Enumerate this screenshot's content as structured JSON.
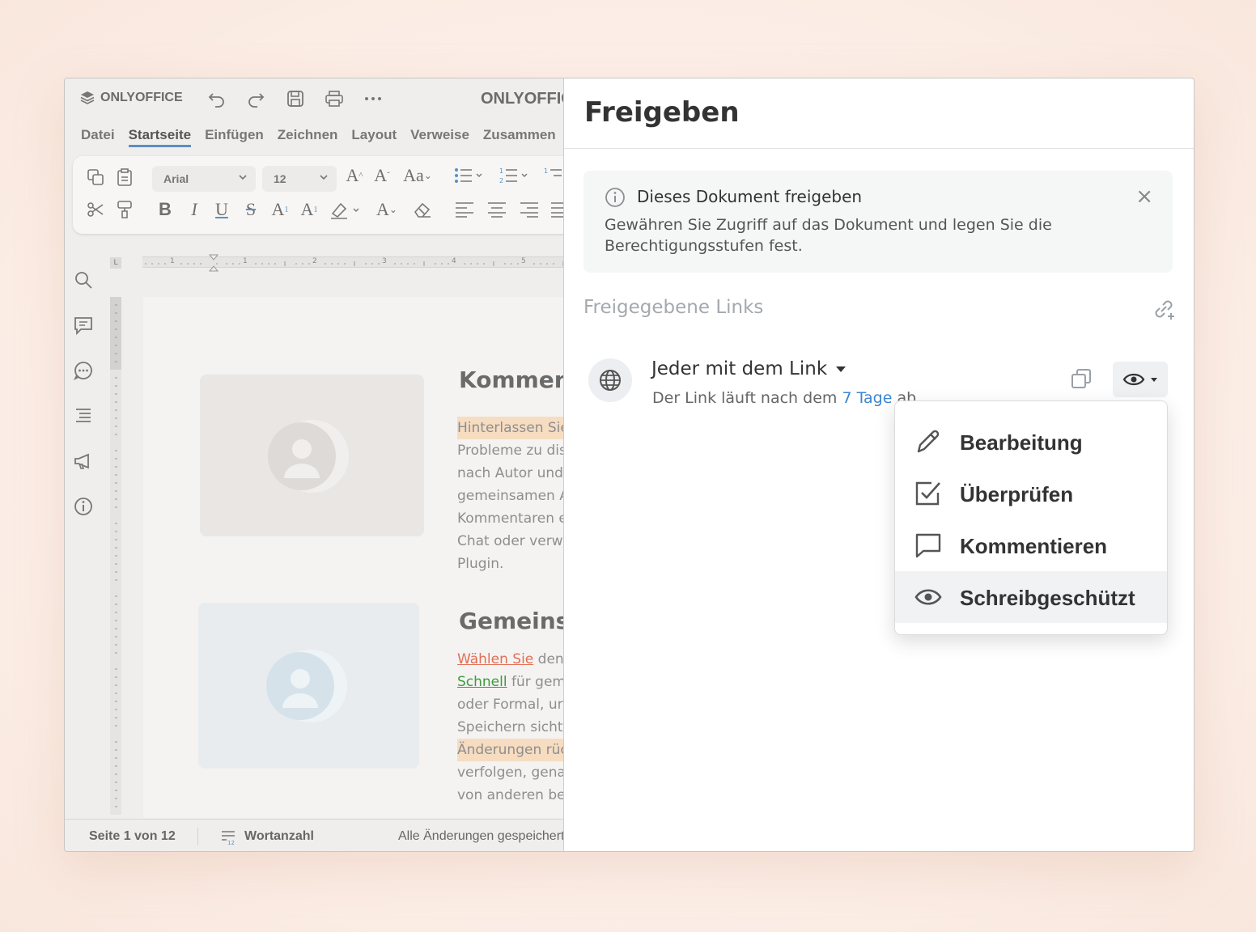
{
  "editor": {
    "logo_text": "ONLYOFFICE",
    "doc_title": "ONLYOFFICE",
    "menu": [
      "Datei",
      "Startseite",
      "Einfügen",
      "Zeichnen",
      "Layout",
      "Verweise",
      "Zusammen"
    ],
    "active_menu_index": 1,
    "font_name": "Arial",
    "font_size": "12",
    "ruler_numbers": [
      "1",
      "1",
      "2",
      "3",
      "4",
      "5"
    ],
    "ruler_corner": "L",
    "content": {
      "heading1": "Komment",
      "para1": [
        "Hinterlassen Sie",
        "Probleme zu dis",
        "nach Autor und",
        "gemeinsamen A",
        "Kommentaren e",
        "Chat oder verw",
        "Plugin."
      ],
      "heading2": "Gemeinsa",
      "para2_l1_red": "Wählen Sie",
      "para2_l1_rest": " den",
      "para2_l2_green": "Schnell",
      "para2_l2_rest": " für gem",
      "para2_rest": [
        "oder Formal, ur",
        "Speichern sicht"
      ],
      "para2_hl": "Änderungen rüc",
      "para2_end": [
        "verfolgen, gena",
        "von anderen be"
      ]
    },
    "status": {
      "page": "Seite 1 von 12",
      "word_count": "Wortanzahl",
      "saved": "Alle Änderungen gespeichert"
    }
  },
  "share": {
    "title": "Freigeben",
    "info": {
      "title": "Dieses Dokument freigeben",
      "text": "Gewähren Sie Zugriff auf das Dokument und legen Sie die Berechtigungsstufen fest.",
      "close": "×"
    },
    "links_label": "Freigegebene Links",
    "link": {
      "name": "Jeder mit dem Link",
      "desc_prefix": "Der Link läuft nach dem ",
      "desc_days": "7 Tage",
      "desc_suffix": " ab"
    },
    "access_options": [
      {
        "label": "Bearbeitung",
        "icon": "pencil-icon"
      },
      {
        "label": "Überprüfen",
        "icon": "review-icon"
      },
      {
        "label": "Kommentieren",
        "icon": "comment-icon"
      },
      {
        "label": "Schreibgeschützt",
        "icon": "eye-icon"
      }
    ],
    "selected_option_index": 3
  },
  "colors": {
    "accent_blue": "#3b86d1",
    "tab_underline": "#5b8fc7",
    "highlight": "#f6dcc0"
  }
}
